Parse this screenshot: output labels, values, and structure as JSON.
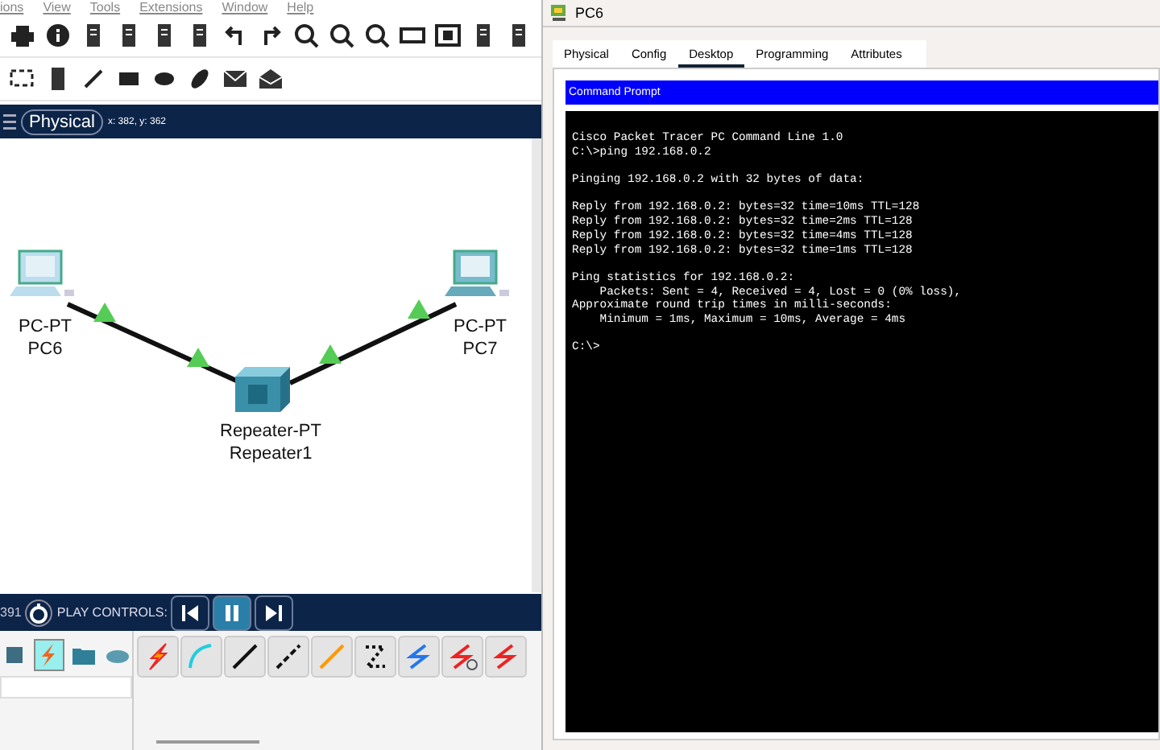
{
  "menu_bar": [
    "ions",
    "View",
    "Tools",
    "Extensions",
    "Window",
    "Help"
  ],
  "workspace": {
    "mode": "Physical",
    "coordinates": "x: 382, y: 362"
  },
  "devices": [
    {
      "kind": "pc",
      "model": "PC-PT",
      "name": "PC6"
    },
    {
      "kind": "repeater",
      "model": "Repeater-PT",
      "name": "Repeater1"
    },
    {
      "kind": "pc",
      "model": "PC-PT",
      "name": "PC7"
    }
  ],
  "simulation": {
    "time": "391",
    "label": "PLAY CONTROLS:",
    "buttons": [
      {
        "kind": "back",
        "selected": false
      },
      {
        "kind": "pause",
        "selected": true
      },
      {
        "kind": "forward",
        "selected": false
      }
    ]
  },
  "device_categories": [
    {
      "kind": "misc",
      "selected": false
    },
    {
      "kind": "connections",
      "selected": true
    },
    {
      "kind": "folder",
      "selected": false
    },
    {
      "kind": "cloud",
      "selected": false
    }
  ],
  "dialog": {
    "title": "PC6",
    "tabs": [
      {
        "label": "Physical",
        "selected": false
      },
      {
        "label": "Config",
        "selected": false
      },
      {
        "label": "Desktop",
        "selected": true
      },
      {
        "label": "Programming",
        "selected": false
      },
      {
        "label": "Attributes",
        "selected": false
      }
    ],
    "panel_title": "Command Prompt",
    "terminal_blocks": [
      [
        "Cisco Packet Tracer PC Command Line 1.0",
        "C:\\>ping 192.168.0.2"
      ],
      [
        "Pinging 192.168.0.2 with 32 bytes of data:"
      ],
      [
        "Reply from 192.168.0.2: bytes=32 time=10ms TTL=128",
        "Reply from 192.168.0.2: bytes=32 time=2ms TTL=128",
        "Reply from 192.168.0.2: bytes=32 time=4ms TTL=128",
        "Reply from 192.168.0.2: bytes=32 time=1ms TTL=128"
      ],
      [
        "Ping statistics for 192.168.0.2:",
        "    Packets: Sent = 4, Received = 4, Lost = 0 (0% loss),",
        "Approximate round trip times in milli-seconds:",
        "    Minimum = 1ms, Maximum = 10ms, Average = 4ms"
      ],
      [
        "C:\\>"
      ]
    ]
  }
}
